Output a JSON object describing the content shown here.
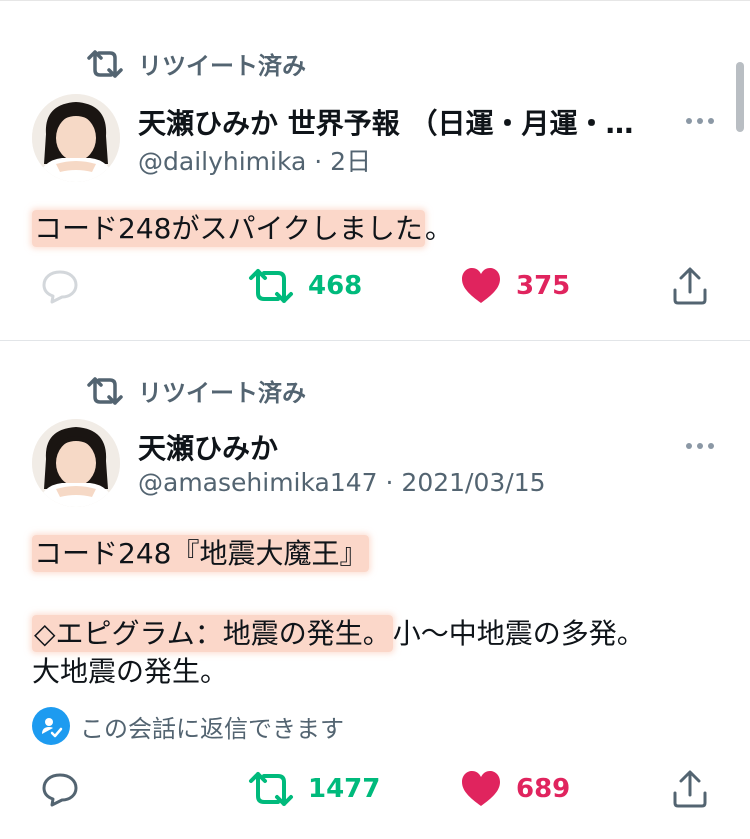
{
  "tweets": [
    {
      "retweet_label": "リツイート済み",
      "author_name": "天瀬ひみか 世界予報 （日運・月運・…",
      "handle": "@dailyhimika",
      "time": "· 2日",
      "text_highlight": "コード248がスパイクしました",
      "text_tail": "。",
      "retweets": "468",
      "likes": "375"
    },
    {
      "retweet_label": "リツイート済み",
      "author_name": "天瀬ひみか",
      "handle": "@amasehimika147",
      "time": "· 2021/03/15",
      "line1_highlight": "コード248『地震大魔王』",
      "line2_highlight": "◇エピグラム：地震の発生。",
      "line2_tail": "小〜中地震の多発。",
      "line3": "大地震の発生。",
      "reply_note": "この会話に返信できます",
      "retweets": "1477",
      "likes": "689"
    }
  ],
  "colors": {
    "retweet_green": "#00ba7c",
    "like_pink": "#e0245e",
    "highlight": "#fbd7c9",
    "badge_blue": "#1d9bf0"
  },
  "icons": [
    "retweet-icon",
    "reply-icon",
    "heart-icon",
    "share-icon",
    "more-icon",
    "reply-badge-icon"
  ]
}
